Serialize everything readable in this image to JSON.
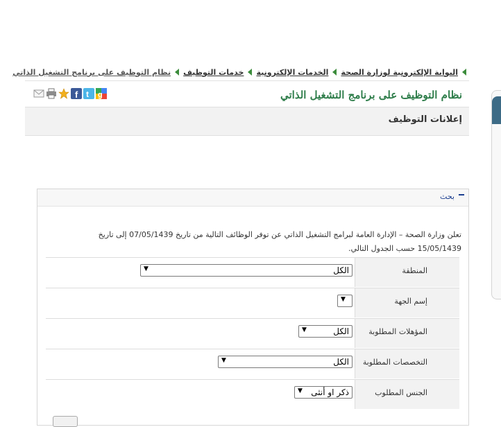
{
  "breadcrumb": {
    "items": [
      "البوابة الإلكترونية لوزارة الصحة",
      "الخدمات الإلكترونية",
      "خدمات التوظيف",
      "نظام التوظيف على برنامج التشغيل الذاتي"
    ]
  },
  "page": {
    "title": "نظام التوظيف على برنامج التشغيل الذاتي",
    "section_title": "إعلانات التوظيف"
  },
  "share_icons": [
    "google-plus-icon",
    "twitter-icon",
    "facebook-icon",
    "favorite-star-icon",
    "print-icon",
    "email-icon"
  ],
  "search": {
    "panel_label": "بحث",
    "intro_line1": "تعلن وزارة الصحة – الإدارة العامة لبرامج التشغيل الذاتي عن توفر الوظائف التالية من تاريخ 07/05/1439 إلى تاريخ",
    "intro_line2": "15/05/1439 حسب الجدول التالي.",
    "fields": [
      {
        "label": "المنطقة",
        "value": "الكل"
      },
      {
        "label": "إسم الجهة",
        "value": ""
      },
      {
        "label": "المؤهلات المطلوبة",
        "value": "الكل"
      },
      {
        "label": "التخصصات المطلوبة",
        "value": "الكل"
      },
      {
        "label": "الجنس المطلوب",
        "value": "ذكر او أنثى"
      }
    ]
  },
  "colors": {
    "title_green": "#2e7d4a",
    "link_blue": "#1a3d8f",
    "accent_blue": "#3d6b86"
  }
}
